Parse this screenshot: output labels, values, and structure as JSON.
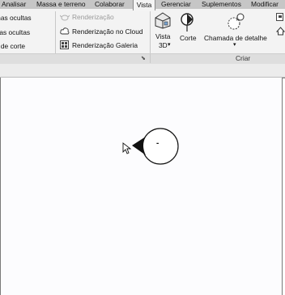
{
  "tabs": [
    {
      "label": "Analisar",
      "active": false
    },
    {
      "label": "Massa e terreno",
      "active": false
    },
    {
      "label": "Colaborar",
      "active": false
    },
    {
      "label": "Vista",
      "active": true
    },
    {
      "label": "Gerenciar",
      "active": false
    },
    {
      "label": "Suplementos",
      "active": false
    },
    {
      "label": "Modificar",
      "active": false
    }
  ],
  "graphics_panel": {
    "hidden_lines_1": "Linhas ocultas",
    "hidden_lines_2": "Remover linhas ocultas",
    "section_item": "Linha de corte"
  },
  "render_panel": {
    "render": "Renderização",
    "render_cloud": "Renderização  no Cloud",
    "render_gallery": "Renderização  Galeria"
  },
  "create_panel": {
    "title": "Criar",
    "view3d_line1": "Vista",
    "view3d_line2": "3D",
    "section": "Corte",
    "callout": "Chamada de detalhe"
  },
  "canvas": {
    "section_marker_text": "-"
  },
  "colors": {
    "tab_bar": "#c6c6c6",
    "ribbon": "#f3f3f3",
    "canvas": "#fcfcfe"
  }
}
